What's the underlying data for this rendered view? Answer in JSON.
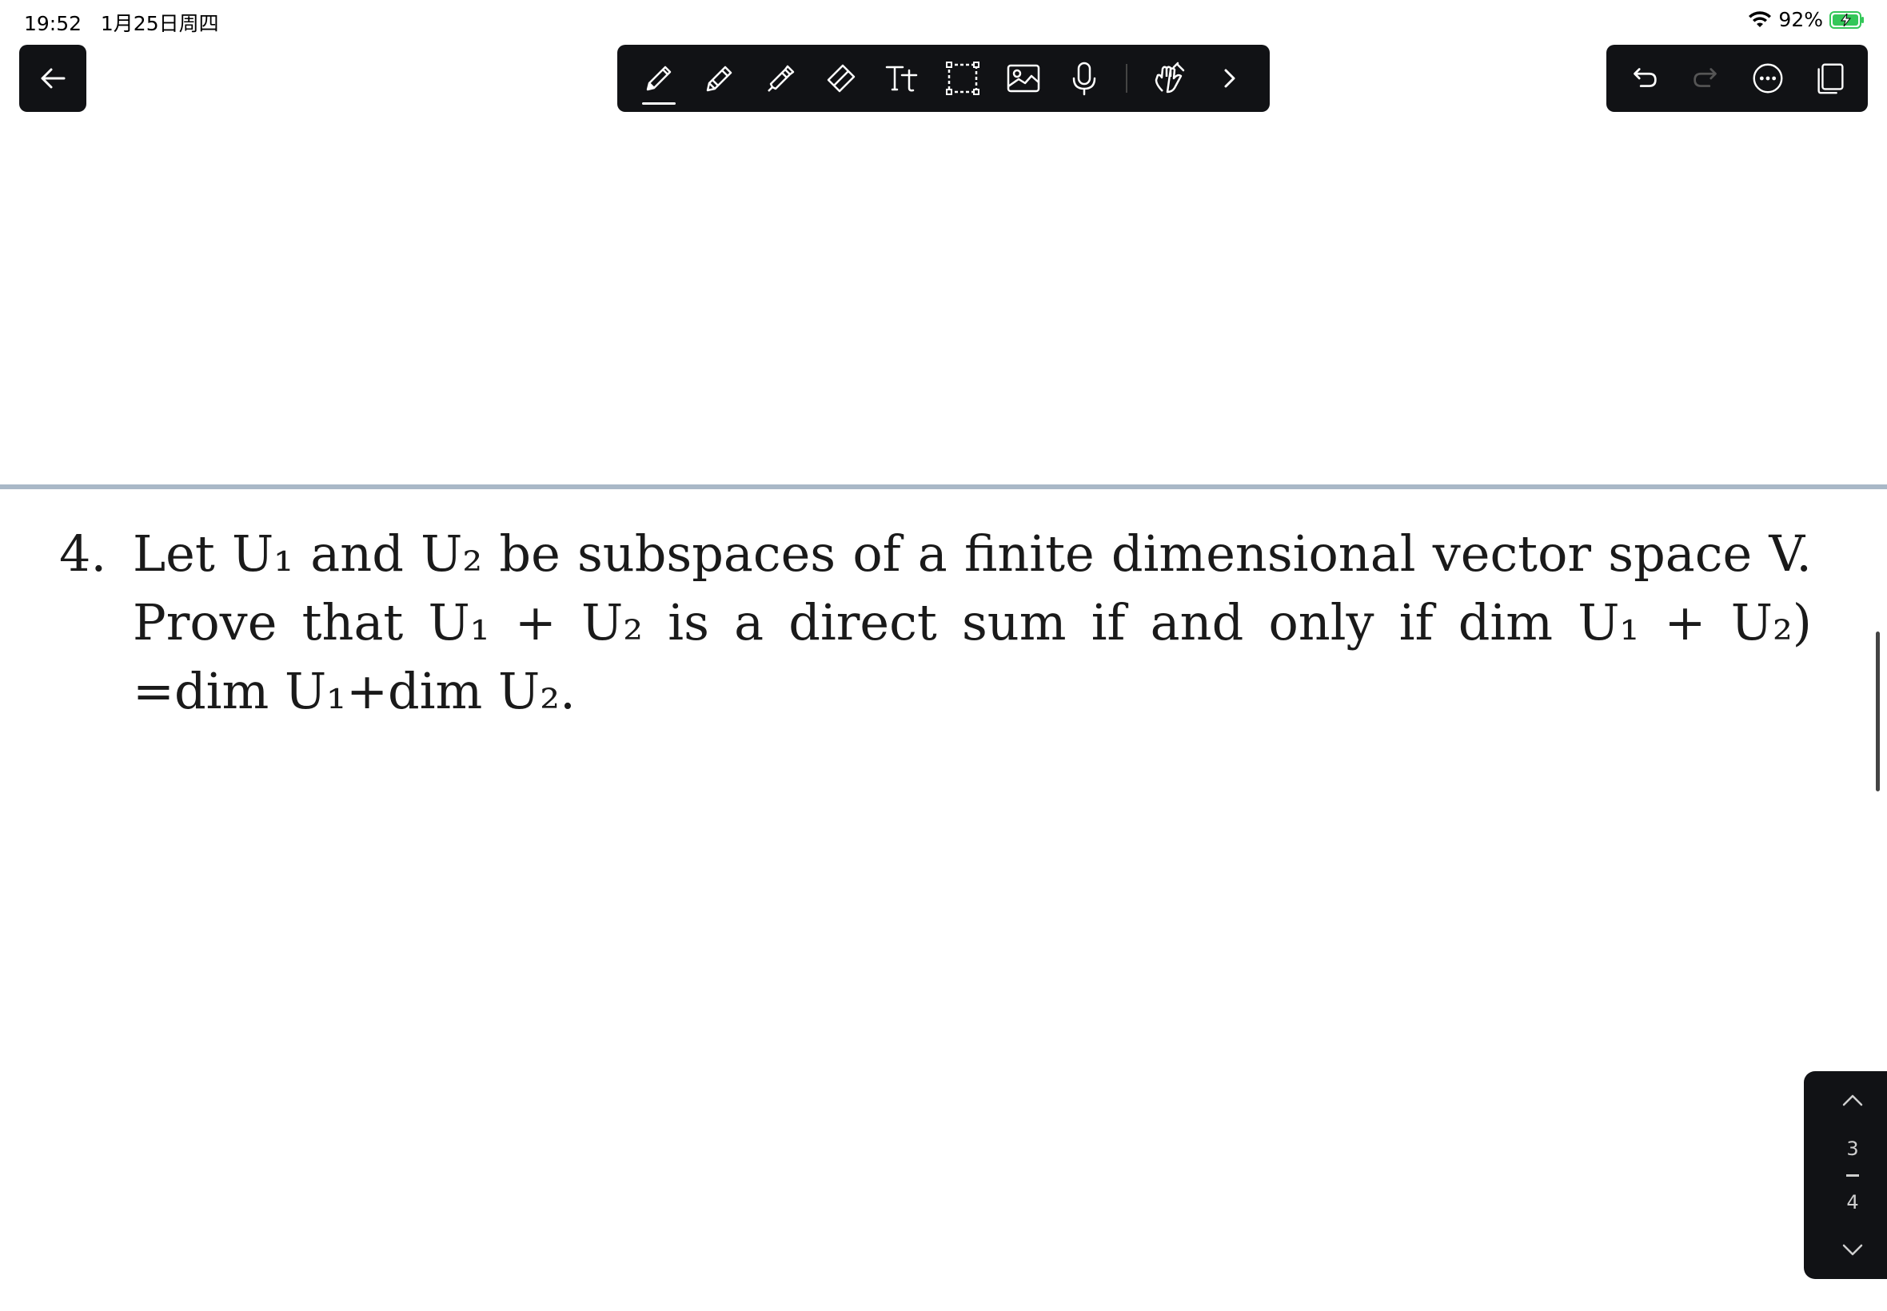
{
  "status_bar": {
    "time": "19:52",
    "date": "1月25日周四",
    "battery": "92%",
    "icons": [
      "wifi-icon",
      "battery-charging-icon"
    ]
  },
  "toolbar": {
    "tools": [
      "pen-icon",
      "pencil-icon",
      "highlighter-icon",
      "eraser-icon",
      "text-icon",
      "lasso-select-icon",
      "image-icon",
      "microphone-icon",
      "touch-draw-icon",
      "expand-chevron-icon"
    ],
    "actions": [
      "undo-icon",
      "redo-icon",
      "more-icon",
      "pages-icon"
    ]
  },
  "document": {
    "problem_number": "4.",
    "problem_text": "Let U₁ and U₂ be subspaces of a finite dimensional vector space V. Prove that U₁ + U₂ is a direct sum if and only if dim U₁ + U₂) =dim U₁+dim U₂."
  },
  "page_nav": {
    "current": "3",
    "total": "4"
  },
  "colors": {
    "toolbar_bg": "#111215",
    "separator": "#a9b8c7",
    "battery_fill": "#34c759"
  }
}
